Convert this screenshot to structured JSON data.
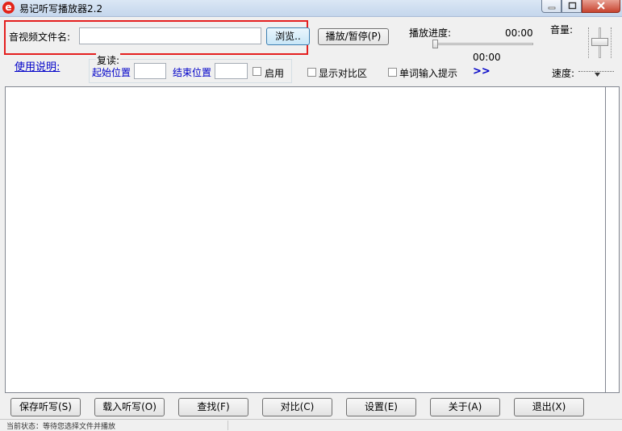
{
  "window": {
    "title": "易记听写播放器2.2",
    "icon_letter": "e"
  },
  "file": {
    "label": "音视频文件名:",
    "value": "",
    "browse_label": "浏览..",
    "play_pause_label": "播放/暂停(P)"
  },
  "progress": {
    "label": "播放进度:",
    "time_total": "00:00",
    "time_current": "00:00",
    "position": 0
  },
  "volume": {
    "label": "音量:"
  },
  "speed": {
    "label": "速度:"
  },
  "help_link": "使用说明:",
  "repeat": {
    "label": "复读:",
    "start_label": "起始位置",
    "start_value": "",
    "end_label": "结束位置",
    "end_value": "",
    "enable_label": "启用",
    "enable_checked": false
  },
  "options": {
    "show_compare_label": "显示对比区",
    "show_compare_checked": false,
    "word_hint_label": "单词输入提示",
    "word_hint_checked": false,
    "expand_label": ">>"
  },
  "editor": {
    "text": ""
  },
  "buttons": {
    "save": "保存听写(S)",
    "load": "载入听写(O)",
    "find": "查找(F)",
    "compare": "对比(C)",
    "settings": "设置(E)",
    "about": "关于(A)",
    "exit": "退出(X)"
  },
  "status": {
    "text": "当前状态：等待您选择文件并播放"
  },
  "colors": {
    "highlight_border": "#e41f1f",
    "link_blue": "#0000c8"
  }
}
